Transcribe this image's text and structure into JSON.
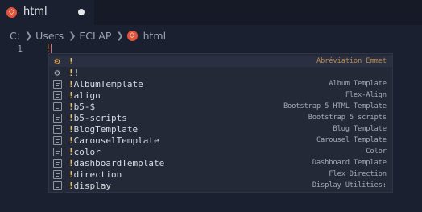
{
  "tab": {
    "title": "html",
    "file_icon": "html-file-icon"
  },
  "breadcrumb": {
    "drive": "C:",
    "folder1": "Users",
    "folder2": "ECLAP",
    "file": "html"
  },
  "editor": {
    "line_number": "1",
    "line_text": "!"
  },
  "suggestions": [
    {
      "label": "!",
      "detail": "Abréviation Emmet",
      "icon": "gear-icon",
      "selected": true
    },
    {
      "label": "!!",
      "detail": "",
      "icon": "gear-icon",
      "selected": false
    },
    {
      "label": "!AlbumTemplate",
      "detail": "Album Template",
      "icon": "snippet-icon",
      "selected": false
    },
    {
      "label": "!align",
      "detail": "Flex-Align",
      "icon": "snippet-icon",
      "selected": false
    },
    {
      "label": "!b5-$",
      "detail": "Bootstrap 5 HTML Template",
      "icon": "snippet-icon",
      "selected": false
    },
    {
      "label": "!b5-scripts",
      "detail": "Bootstrap 5 scripts",
      "icon": "snippet-icon",
      "selected": false
    },
    {
      "label": "!BlogTemplate",
      "detail": "Blog Template",
      "icon": "snippet-icon",
      "selected": false
    },
    {
      "label": "!CarouselTemplate",
      "detail": "Carousel Template",
      "icon": "snippet-icon",
      "selected": false
    },
    {
      "label": "!color",
      "detail": "Color",
      "icon": "snippet-icon",
      "selected": false
    },
    {
      "label": "!dashboardTemplate",
      "detail": "Dashboard Template",
      "icon": "snippet-icon",
      "selected": false
    },
    {
      "label": "!direction",
      "detail": "Flex Direction",
      "icon": "snippet-icon",
      "selected": false
    },
    {
      "label": "!display",
      "detail": "Display Utilities:",
      "icon": "snippet-icon",
      "selected": false
    }
  ],
  "colors": {
    "accent": "#e0543c",
    "match": "#f2c14e",
    "background": "#1b2030",
    "widget": "#242938"
  }
}
